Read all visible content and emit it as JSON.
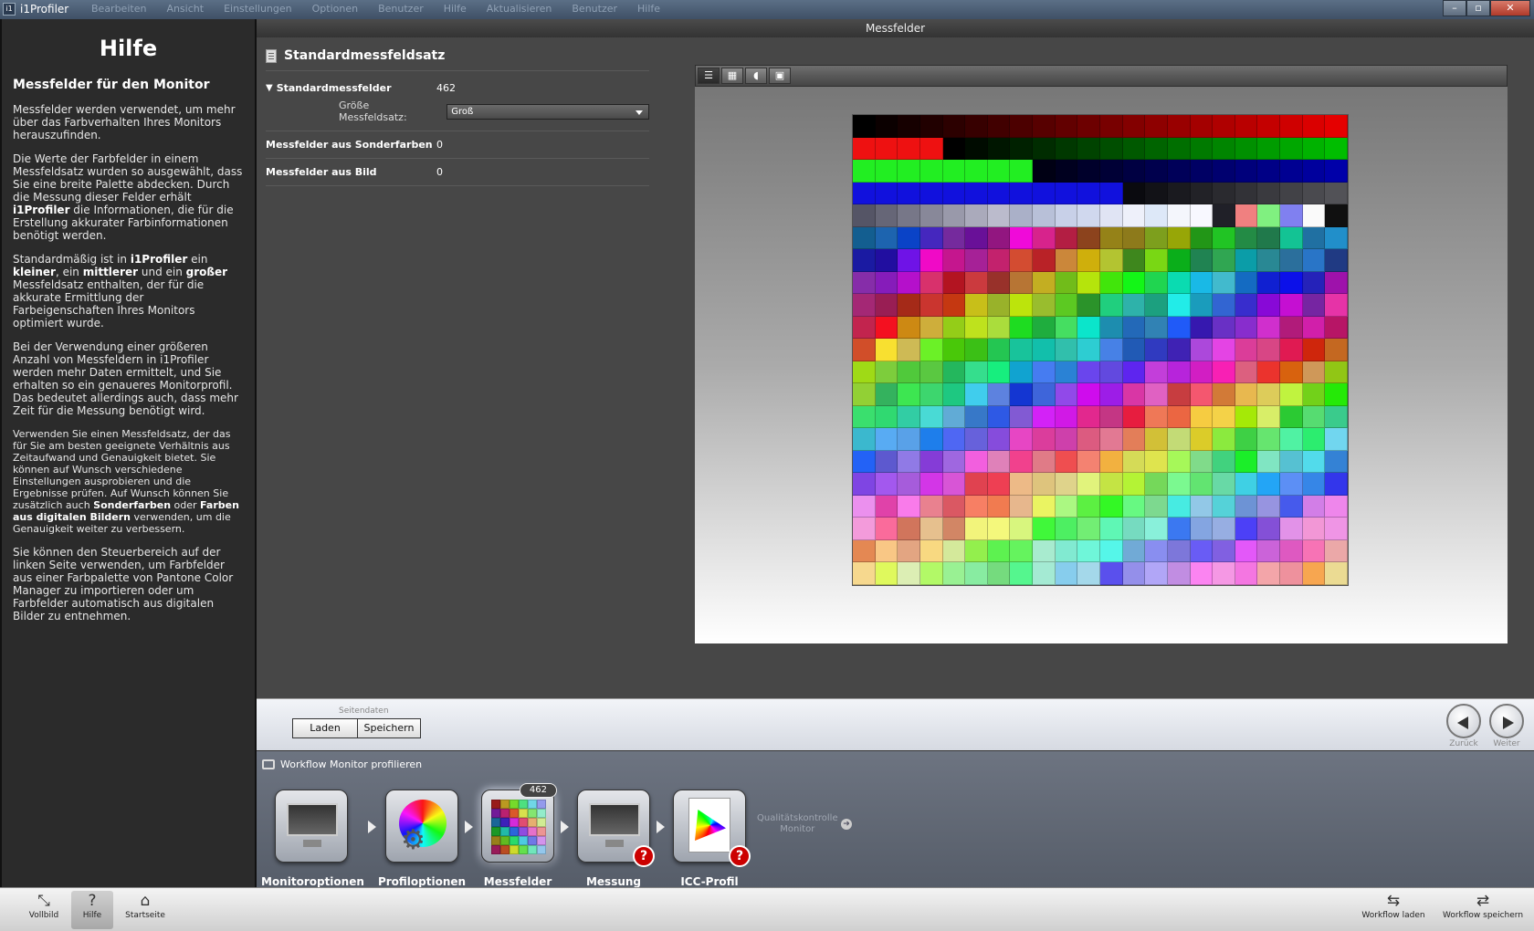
{
  "window": {
    "title": "i1Profiler",
    "menu": [
      "Bearbeiten",
      "Ansicht",
      "Einstellungen",
      "Optionen",
      "Benutzer",
      "Hilfe",
      "Aktualisieren",
      "Benutzer",
      "Hilfe"
    ],
    "minimize_label": "–",
    "maximize_label": "▫",
    "close_label": "✕"
  },
  "help": {
    "heading": "Hilfe",
    "subheading": "Messfelder für den Monitor",
    "p1": "Messfelder werden verwendet, um mehr über das Farbverhalten Ihres Monitors herauszufinden.",
    "p2a": "Die Werte der Farbfelder in einem Messfeldsatz wurden so ausgewählt, dass Sie eine breite Palette abdecken. Durch die Messung dieser Felder erhält ",
    "p2b": "i1Profiler",
    "p2c": " die Informationen, die für die Erstellung akkurater Farbinformationen benötigt werden.",
    "p3a": "Standardmäßig ist in ",
    "p3b": "i1Profiler",
    "p3c": " ein ",
    "p3d": "kleiner",
    "p3e": ", ein ",
    "p3f": "mittlerer",
    "p3g": " und ein ",
    "p3h": "großer",
    "p3i": " Messfeldsatz enthalten, der für die akkurate Ermittlung der Farbeigenschaften Ihres Monitors optimiert wurde.",
    "p4": "Bei der Verwendung einer größeren Anzahl von Messfeldern in i1Profiler werden mehr Daten ermittelt, und Sie erhalten so ein genaueres Monitorprofil. Das bedeutet allerdings auch, dass mehr Zeit für die Messung benötigt wird.",
    "p5a": "Verwenden Sie einen Messfeldsatz, der das für Sie am besten geeignete Verhältnis aus Zeitaufwand und Genauigkeit bietet. Sie können auf Wunsch verschiedene Einstellungen ausprobieren und die Ergebnisse prüfen. Auf Wunsch können Sie zusätzlich auch ",
    "p5b": "Sonderfarben",
    "p5c": " oder ",
    "p5d": "Farben aus digitalen Bildern",
    "p5e": " verwenden, um die Genauigkeit weiter zu verbessern.",
    "p6": "Sie können den Steuerbereich auf der linken Seite verwenden, um Farbfelder aus einer Farbpalette von Pantone Color Manager zu importieren oder um Farbfelder automatisch aus digitalen Bilder zu entnehmen."
  },
  "section_title": "Messfelder",
  "settings": {
    "title": "Standardmessfeldsatz",
    "standard_label": "Standardmessfelder",
    "standard_value": "462",
    "size_label": "Größe Messfeldsatz:",
    "size_value": "Groß",
    "spot_label": "Messfelder aus Sonderfarben",
    "spot_value": "0",
    "image_label": "Messfelder aus Bild",
    "image_value": "0"
  },
  "preview": {
    "toolbar": [
      "list-view-icon",
      "grid-view-icon",
      "spot-color-icon",
      "image-icon"
    ],
    "tool_glyphs": [
      "☰",
      "▦",
      "◖",
      "▣"
    ],
    "columns": 22,
    "rows": 21
  },
  "page_data": {
    "group_label": "Seitendaten",
    "load_label": "Laden",
    "save_label": "Speichern",
    "back_label": "Zurück",
    "next_label": "Weiter"
  },
  "workflow": {
    "title": "Workflow Monitor profilieren",
    "steps": [
      {
        "label": "Monitoroptionen"
      },
      {
        "label": "Profiloptionen"
      },
      {
        "label": "Messfelder",
        "badge": "462"
      },
      {
        "label": "Messung"
      },
      {
        "label": "ICC-Profil"
      }
    ],
    "qc_line1": "Qualitätskontrolle",
    "qc_line2": "Monitor",
    "qc_glyph": "➜",
    "question_glyph": "?"
  },
  "footer": {
    "fullscreen": "Vollbild",
    "help": "Hilfe",
    "home": "Startseite",
    "load_workflow": "Workflow laden",
    "save_workflow": "Workflow speichern"
  }
}
